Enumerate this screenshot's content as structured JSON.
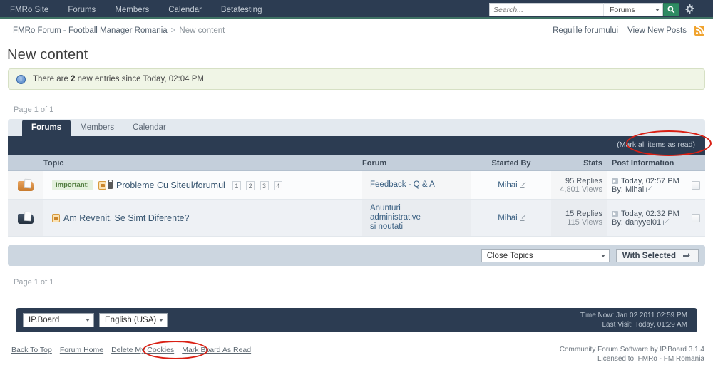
{
  "topnav": {
    "items": [
      {
        "label": "FMRo Site"
      },
      {
        "label": "Forums"
      },
      {
        "label": "Members"
      },
      {
        "label": "Calendar"
      },
      {
        "label": "Betatesting"
      }
    ],
    "search": {
      "placeholder": "Search...",
      "value": "",
      "scope": "Forums",
      "go_icon": "search-icon",
      "settings_icon": "gear-icon"
    }
  },
  "breadcrumb": {
    "root": "FMRo Forum - Football Manager Romania",
    "separator": ">",
    "current": "New content",
    "right_links": [
      {
        "label": "Regulile forumului"
      },
      {
        "label": "View New Posts"
      }
    ],
    "rss_icon": "rss-icon"
  },
  "page": {
    "title": "New content",
    "message": {
      "icon": "info-icon",
      "prefix": "There are ",
      "count": "2",
      "suffix": " new entries since Today, 02:04 PM"
    },
    "pagination_top": "Page 1 of 1",
    "pagination_bottom": "Page 1 of 1"
  },
  "tabs": [
    {
      "label": "Forums",
      "active": true
    },
    {
      "label": "Members",
      "active": false
    },
    {
      "label": "Calendar",
      "active": false
    }
  ],
  "table": {
    "mark_all_as_read": "(Mark all items as read)",
    "headers": {
      "topic": "Topic",
      "forum": "Forum",
      "started_by": "Started By",
      "stats": "Stats",
      "post_information": "Post Information"
    },
    "rows": [
      {
        "folder_icon": "folder-unread-icon",
        "badge": "Important:",
        "icons": [
          "moved-post-icon",
          "locked-icon"
        ],
        "topic": "Probleme Cu Siteul/forumul",
        "pages": [
          "1",
          "2",
          "3",
          "4"
        ],
        "forum": "Feedback - Q & A",
        "started_by": "Mihai",
        "replies": "95 Replies",
        "views": "4,801 Views",
        "post_time": "Today, 02:57 PM",
        "post_by": "By: Mihai"
      },
      {
        "folder_icon": "folder-read-icon",
        "badge": "",
        "icons": [
          "moved-post-icon"
        ],
        "topic": "Am Revenit. Se Simt Diferente?",
        "pages": [],
        "forum": "Anunturi administrative si noutati",
        "started_by": "Mihai",
        "replies": "15 Replies",
        "views": "115 Views",
        "post_time": "Today, 02:32 PM",
        "post_by": "By: danyyel01"
      }
    ]
  },
  "actions": {
    "topic_action": "Close Topics",
    "with_selected": "With Selected",
    "go_icon": "go-arrow-icon"
  },
  "footer": {
    "skin": "IP.Board",
    "language": "English (USA)",
    "time_now": "Time Now: Jan 02 2011 02:59 PM",
    "last_visit": "Last Visit: Today, 01:29 AM",
    "links": [
      {
        "label": "Back To Top"
      },
      {
        "label": "Forum Home"
      },
      {
        "label": "Delete My Cookies"
      },
      {
        "label": "Mark Board As Read"
      }
    ],
    "copyright_line1": "Community Forum Software by IP.Board 3.1.4",
    "copyright_line2": "Licensed to: FMRo - FM Romania"
  },
  "colors": {
    "nav_bg": "#2c3c52",
    "nav_accent": "#3f7264",
    "search_go": "#2e8b63",
    "header_row": "#c4cfdb",
    "action_bar": "#ccd6e0",
    "message_bg": "#f0f5e6",
    "annotation": "#d91f13"
  }
}
